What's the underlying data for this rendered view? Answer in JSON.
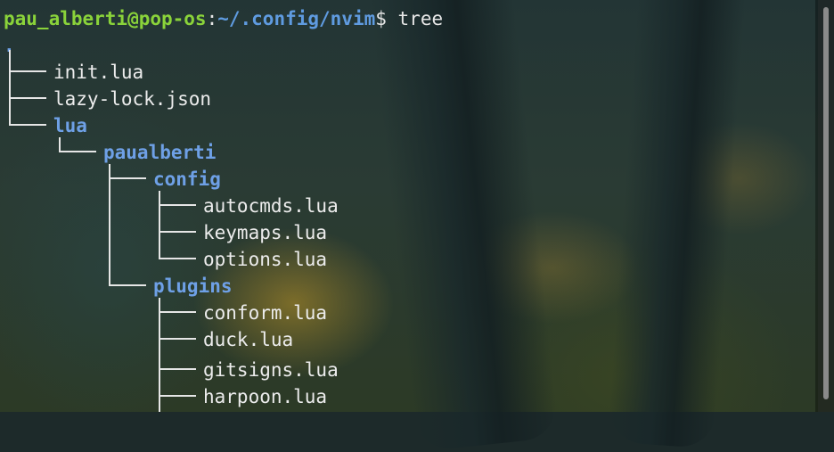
{
  "prompt": {
    "user_host": "pau_alberti@pop-os",
    "colon": ":",
    "path": "~/.config/nvim",
    "symbol": "$",
    "command": " tree"
  },
  "tree": {
    "root": ".",
    "entries": [
      {
        "name": "init.lua",
        "type": "file"
      },
      {
        "name": "lazy-lock.json",
        "type": "file"
      },
      {
        "name": "lua",
        "type": "dir"
      },
      {
        "name": "paualberti",
        "type": "dir"
      },
      {
        "name": "config",
        "type": "dir"
      },
      {
        "name": "autocmds.lua",
        "type": "file"
      },
      {
        "name": "keymaps.lua",
        "type": "file"
      },
      {
        "name": "options.lua",
        "type": "file"
      },
      {
        "name": "plugins",
        "type": "dir"
      },
      {
        "name": "conform.lua",
        "type": "file"
      },
      {
        "name": "duck.lua",
        "type": "file"
      },
      {
        "name": "gitsigns.lua",
        "type": "file"
      },
      {
        "name": "harpoon.lua",
        "type": "file"
      }
    ]
  },
  "colors": {
    "user": "#8ad33a",
    "path": "#5f9be0",
    "dir": "#6ea0e6",
    "text": "#e6e6e6"
  }
}
